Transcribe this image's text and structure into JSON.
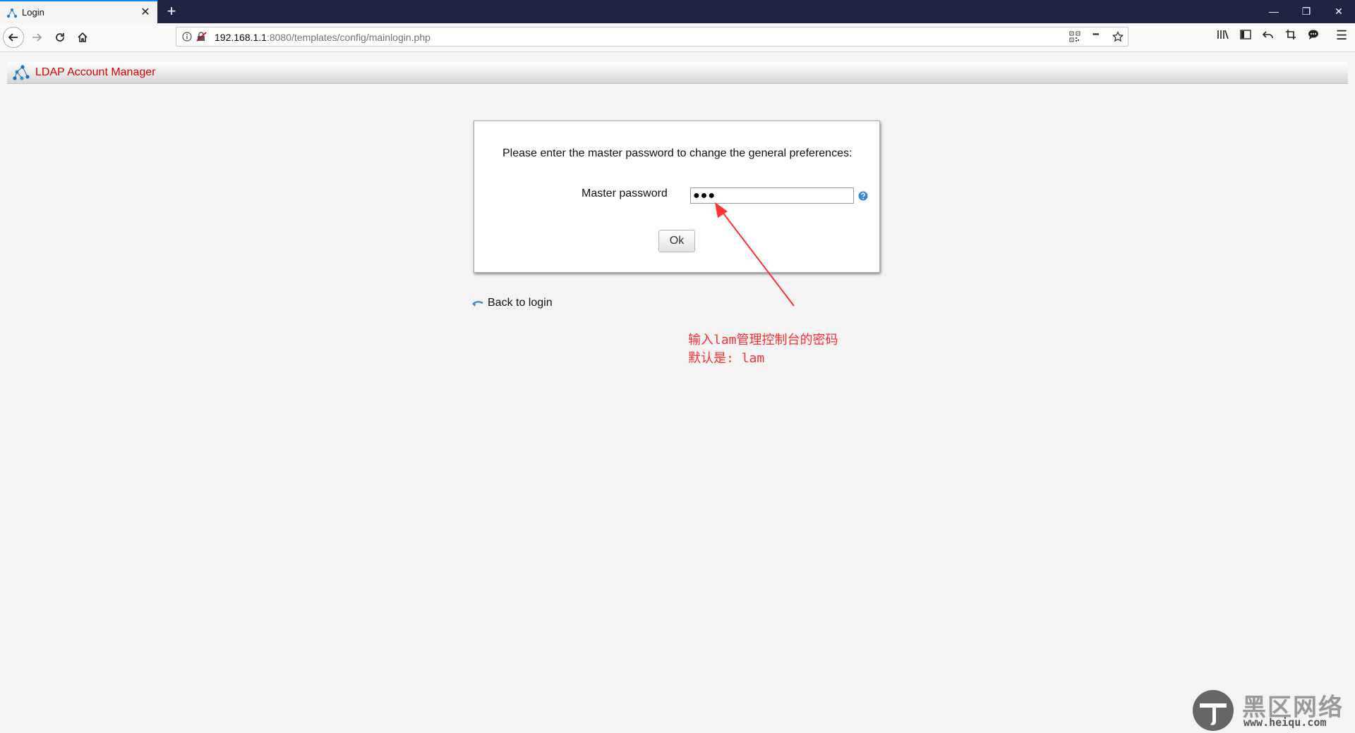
{
  "browser": {
    "tab_title": "Login",
    "tab_close": "✕",
    "new_tab": "+",
    "url_host": "192.168.1.1",
    "url_path": ":8080/templates/config/mainlogin.php",
    "win_min": "—",
    "win_restore": "❐",
    "win_close": "✕",
    "menu_icon": "☰",
    "more_icon": "•••"
  },
  "lam": {
    "title": "LDAP Account Manager"
  },
  "dialog": {
    "prompt": "Please enter the master password to change the general preferences:",
    "password_label": "Master password",
    "password_value": "●●●",
    "ok_label": "Ok"
  },
  "links": {
    "back_to_login": "Back to login"
  },
  "annotation": {
    "line1": "输入lam管理控制台的密码",
    "line2": "默认是: lam"
  },
  "watermark": {
    "cn": "黑区网络",
    "en": "www.heiqu.com"
  },
  "colors": {
    "annotation": "#ff3030",
    "lam_title": "#e00000",
    "tabbar": "#1f2442"
  }
}
